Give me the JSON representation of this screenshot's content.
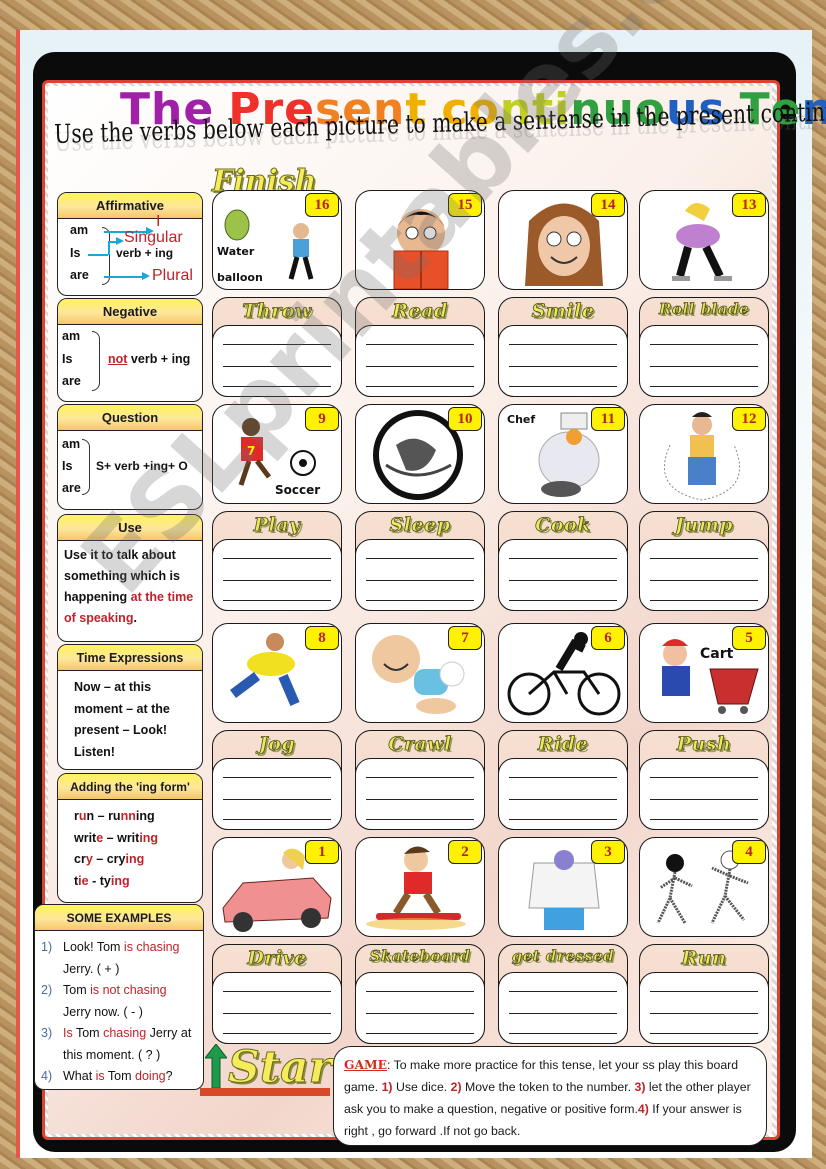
{
  "worksheet": {
    "title": "The Present continuous Tense",
    "title_colors": [
      "#a020a8",
      "#e0187a",
      "#f0302a",
      "#f08020",
      "#f0b000",
      "#c0d020",
      "#30a040",
      "#2060c0",
      "#2030e0",
      "#a020c0"
    ],
    "subtitle": "Use the verbs below each picture to make a sentense in the present continuous",
    "finish_label": "Finish",
    "start_label": "Start",
    "watermark": "ESLprintables.com"
  },
  "sidebar": {
    "affirmative": {
      "heading": "Affirmative",
      "verbs": [
        "am",
        "Is",
        "are"
      ],
      "formula": "verb + ing",
      "subjects": [
        "I",
        "Singular",
        "Plural"
      ]
    },
    "negative": {
      "heading": "Negative",
      "verbs": [
        "am",
        "Is",
        "are"
      ],
      "formula_emph": "not",
      "formula": "verb + ing"
    },
    "question": {
      "heading": "Question",
      "verbs": [
        "am",
        "Is",
        "are"
      ],
      "formula": "S+ verb +ing+ O"
    },
    "use": {
      "heading": "Use",
      "text": "Use it to talk about something which is happening ",
      "emph": "at the time of speaking",
      "end": "."
    },
    "time_expressions": {
      "heading": "Time Expressions",
      "text": "Now – at this moment – at the present – Look! Listen!"
    },
    "ing_form": {
      "heading": "Adding the 'ing form'",
      "rows": [
        {
          "base_a": "r",
          "base_b": "u",
          "base_c": "n",
          "sep": "  – ",
          "ing_a": "ru",
          "ing_b": "nn",
          "ing_c": "ing"
        },
        {
          "base_a": "writ",
          "base_b": "e",
          "base_c": "",
          "sep": " – ",
          "ing_a": "writ",
          "ing_b": "ing",
          "ing_c": ""
        },
        {
          "base_a": "cr",
          "base_b": "y",
          "base_c": "",
          "sep": " – ",
          "ing_a": "cry",
          "ing_b": "ing",
          "ing_c": ""
        },
        {
          "base_a": "t",
          "base_b": "ie",
          "base_c": "",
          "sep": " - ",
          "ing_a": "ty",
          "ing_b": "ing",
          "ing_c": ""
        }
      ]
    },
    "examples": {
      "heading": "SOME EXAMPLES",
      "items": [
        {
          "num": "1)",
          "parts": [
            "Look! Tom ",
            "is chasing",
            " Jerry. ( + )"
          ]
        },
        {
          "num": "2)",
          "parts": [
            "Tom ",
            "is not chasing",
            " Jerry now. ( - )"
          ]
        },
        {
          "num": "3)",
          "parts": [
            "",
            "Is",
            " Tom ",
            "chasing",
            " Jerry at this moment. ( ? )"
          ]
        },
        {
          "num": "4)",
          "parts": [
            "What ",
            "is",
            " Tom ",
            "doing",
            "?"
          ]
        }
      ]
    }
  },
  "board": {
    "cells": [
      {
        "number": "16",
        "verb": "Throw",
        "picture": "water-balloon-throw",
        "caption": "Water balloon"
      },
      {
        "number": "15",
        "verb": "Read",
        "picture": "boy-reading-book"
      },
      {
        "number": "14",
        "verb": "Smile",
        "picture": "girl-smiling"
      },
      {
        "number": "13",
        "verb": "Roll blade",
        "picture": "girl-rollerblading"
      },
      {
        "number": "9",
        "verb": "Play",
        "picture": "girl-playing-soccer",
        "caption": "Soccer"
      },
      {
        "number": "10",
        "verb": "Sleep",
        "picture": "woman-sleeping"
      },
      {
        "number": "11",
        "verb": "Cook",
        "picture": "chef-cooking",
        "caption": "Chef"
      },
      {
        "number": "12",
        "verb": "Jump",
        "picture": "boy-jumping-rope"
      },
      {
        "number": "8",
        "verb": "Jog",
        "picture": "man-jogging"
      },
      {
        "number": "7",
        "verb": "Crawl",
        "picture": "baby-crawling"
      },
      {
        "number": "6",
        "verb": "Ride",
        "picture": "cyclist-riding"
      },
      {
        "number": "5",
        "verb": "Push",
        "picture": "boy-pushing-cart",
        "caption": "Cart"
      },
      {
        "number": "1",
        "verb": "Drive",
        "picture": "woman-driving-car"
      },
      {
        "number": "2",
        "verb": "Skateboard",
        "picture": "boy-skateboarding"
      },
      {
        "number": "3",
        "verb": "get dressed",
        "picture": "boy-getting-dressed"
      },
      {
        "number": "4",
        "verb": "Run",
        "picture": "people-running"
      }
    ]
  },
  "game": {
    "label": "GAME",
    "parts": [
      {
        "t": ": To make more practice for this tense, let your ss play this board game. "
      },
      {
        "b": "1)"
      },
      {
        "t": " Use dice. "
      },
      {
        "b": "2)"
      },
      {
        "t": " Move the token to the number. "
      },
      {
        "b": "3)"
      },
      {
        "t": " let the other player ask you to make a question, negative or positive form."
      },
      {
        "b": "4)"
      },
      {
        "t": " If your answer is right , go forward .If not go back."
      }
    ]
  },
  "colors": {
    "accent_red": "#c0222a",
    "number_badge": "#fff200",
    "arrow_blue": "#1aa6d8",
    "start_arrow": "#1f9a4a"
  }
}
